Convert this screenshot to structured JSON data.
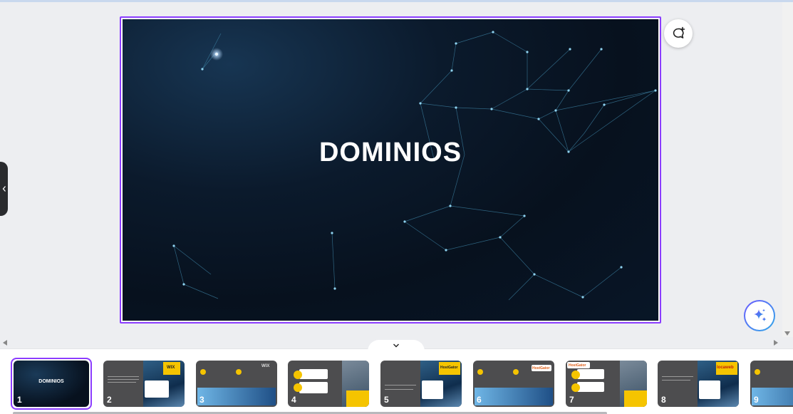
{
  "slide": {
    "title": "DOMINIOS"
  },
  "toolbar": {
    "comment_icon": "add-comment-icon",
    "magic_icon": "magic-sparkle-icon",
    "collapse_icon": "chevron-down-icon",
    "side_handle_icon": "chevron-left-icon"
  },
  "colors": {
    "selection": "#8b3dff",
    "slide_bg": "#081627",
    "thumb_bg": "#4d4d4f",
    "accent_yellow": "#f5c400"
  },
  "thumbnails": [
    {
      "number": "1",
      "title": "DOMINIOS",
      "logo": ""
    },
    {
      "number": "2",
      "title": "",
      "logo": "WIX"
    },
    {
      "number": "3",
      "title": "",
      "logo": "WIX"
    },
    {
      "number": "4",
      "title": "",
      "logo": ""
    },
    {
      "number": "5",
      "title": "",
      "logo": "HostGator"
    },
    {
      "number": "6",
      "title": "",
      "logo": "HostGator"
    },
    {
      "number": "7",
      "title": "",
      "logo": "HostGator"
    },
    {
      "number": "8",
      "title": "",
      "logo": "locaweb"
    },
    {
      "number": "9",
      "title": "",
      "logo": ""
    }
  ]
}
